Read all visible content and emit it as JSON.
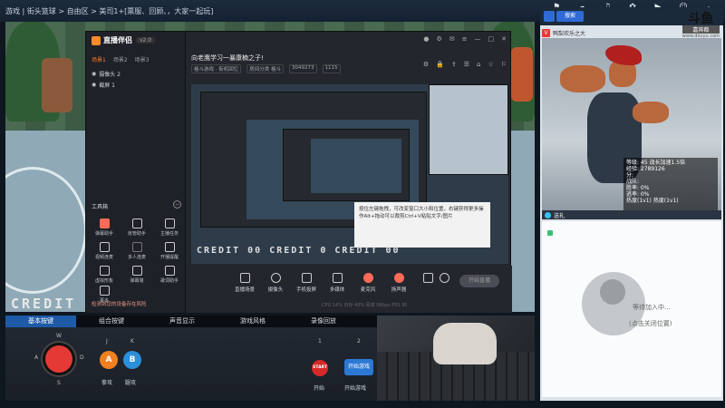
{
  "topbar": {
    "breadcrumb": "游戏 | 街头篮球 > 自由区 > 美司1+[票服、回顾、，大家一起玩]",
    "icons": [
      {
        "icon": "broadcast-icon",
        "label": "开播"
      },
      {
        "icon": "cloud-icon",
        "label": "直播"
      },
      {
        "icon": "music-icon",
        "label": "音效"
      },
      {
        "icon": "gift-icon",
        "label": "礼物"
      },
      {
        "icon": "video-icon",
        "label": "录像"
      },
      {
        "icon": "user-icon",
        "label": "主播"
      },
      {
        "icon": "number-icon",
        "label": "0"
      }
    ]
  },
  "game": {
    "credit_text": "CREDIT  00     CREDIT  0     CREDIT  00"
  },
  "app": {
    "name": "直播伴侣",
    "version": "v2.0",
    "scene_tabs": [
      "场景1",
      "场景2",
      "场景3"
    ],
    "sources": [
      "摄像头 2",
      "截屏 1"
    ],
    "tools_title": "工具箱",
    "tools": [
      {
        "label": "弹幕助手",
        "color": "#ff6b57"
      },
      {
        "label": "房管助手",
        "color": "#6b8cff"
      },
      {
        "label": "主播任务",
        "color": "#ffffff"
      },
      {
        "label": "视频连麦",
        "color": "#ffffff"
      },
      {
        "label": "多人连麦",
        "color": "#888888"
      },
      {
        "label": "开播提醒",
        "color": "#ffffff"
      },
      {
        "label": "虚拟形象",
        "color": "#ffffff"
      },
      {
        "label": "弹幕墙",
        "color": "#ffffff"
      },
      {
        "label": "歌词助手",
        "color": "#ffffff"
      },
      {
        "label": "更多",
        "color": "#ffffff"
      }
    ],
    "warning": "检测到您的设备存在风险",
    "room_title": "向老鹰学习一暴康楠之子!",
    "room_meta": [
      "格斗游戏 · 街机回忆",
      "房间分类 格斗",
      "3049273",
      "1115"
    ],
    "header_icons": [
      "gear-icon",
      "lock-icon",
      "share-icon",
      "list-icon",
      "tag-icon",
      "star-icon",
      "bell-icon"
    ],
    "tip_text": "按住左键拖拽，可改变窗口大小和位置，右键获得更多操作Alt+拖动可以裁剪Ctrl+V粘贴文字/图片",
    "bottom_tools": [
      "直播场景",
      "摄像头",
      "手机投屏",
      "多媒体",
      "麦克风",
      "扬声器"
    ],
    "start_live": "开始直播",
    "stats_line": "CPU 14%   内存 40%   码率 0Kbps   FPS 30"
  },
  "pad": {
    "tabs": [
      "基本按键",
      "组合按键",
      "声音显示",
      "游戏风格",
      "录像回放"
    ],
    "directions": {
      "up": "W",
      "left": "A",
      "right": "D",
      "down": "S"
    },
    "keys": [
      {
        "key": "J",
        "label": "A",
        "caption": "拳攻",
        "color": "#f08020"
      },
      {
        "key": "K",
        "label": "B",
        "caption": "腿攻",
        "color": "#2b90d9"
      }
    ],
    "record": [
      {
        "num": "1",
        "label": "START",
        "caption": "开始"
      },
      {
        "num": "2",
        "label": "开始游戏",
        "caption": "开始游戏"
      }
    ]
  },
  "right": {
    "search": "搜索",
    "streamer_line": "鸭梨欢乐之大",
    "douyu_brand": "斗鱼",
    "douyu_tag": "嘉宾都",
    "douyu_url": "www.douyu.com",
    "stats": [
      "等级: 45  战长加速1.5倍",
      "经验: 2789126",
      "分:",
      "战队:",
      "胜率: 0%",
      "逃率: 0%",
      "热度(1v1)  热度(1v1)"
    ],
    "chat_label": "送礼",
    "wait_line1": "等待加入中...",
    "wait_line2": "(点击关闭位置)"
  }
}
